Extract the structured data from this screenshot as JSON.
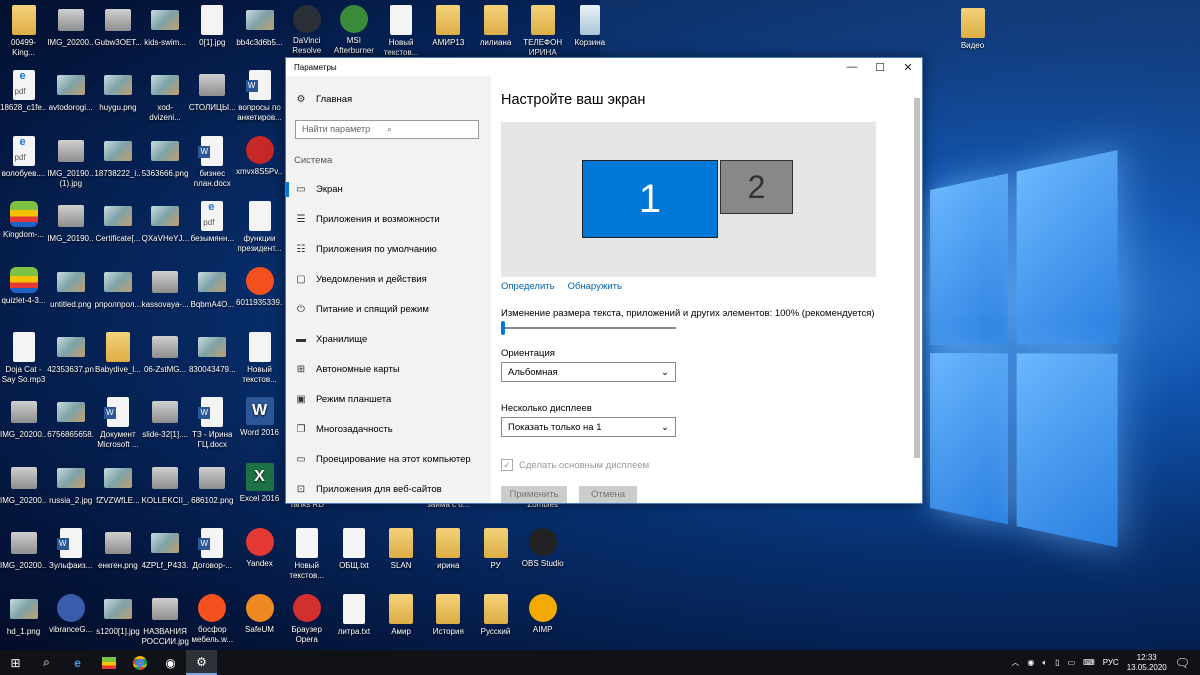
{
  "desktop": {
    "grid": [
      [
        [
          "00499-King...",
          "folder"
        ],
        [
          "IMG_20200...",
          "img"
        ],
        [
          "Gubw3OET...",
          "img"
        ],
        [
          "kids-swim...",
          "pic"
        ],
        [
          "0[1].jpg",
          "doc"
        ],
        [
          "bb4c3d6b5...",
          "pic"
        ],
        [
          "DaVinci Resolve Pro...",
          "app",
          "#2a2f38"
        ],
        [
          "MSI Afterburner",
          "app",
          "#3a8a3a"
        ],
        [
          "Новый текстов...",
          "doc"
        ],
        [
          "АМИР13",
          "folder"
        ],
        [
          "лилиана",
          "folder"
        ],
        [
          "ТЕЛЕФОН ИРИНА",
          "folder"
        ],
        [
          "Корзина",
          "bin"
        ]
      ],
      [
        [
          "18628_c1fe...",
          "pdf"
        ],
        [
          "avtodorogi...",
          "pic"
        ],
        [
          "huygu.png",
          "pic"
        ],
        [
          "xod-dvizeni...",
          "pic"
        ],
        [
          "СТОЛИЦЫ...",
          "img"
        ],
        [
          "вопросы по анкетиров...",
          "word"
        ]
      ],
      [
        [
          "волобуев....",
          "pdf"
        ],
        [
          "IMG_20190... (1).jpg",
          "img"
        ],
        [
          "18738222_i...",
          "pic"
        ],
        [
          "5363666.png",
          "pic"
        ],
        [
          "бизнес план.docx",
          "word"
        ],
        [
          "xmvx8S5Pv...",
          "app",
          "#c62828"
        ]
      ],
      [
        [
          "Kingdom-...",
          "bs"
        ],
        [
          "IMG_20190...",
          "img"
        ],
        [
          "Certificate[...",
          "pic"
        ],
        [
          "QXaVHeYJ...",
          "pic"
        ],
        [
          "безымянн...",
          "pdf"
        ],
        [
          "функции президент...",
          "doc"
        ]
      ],
      [
        [
          "quizlet-4-3...",
          "bs"
        ],
        [
          "untitled.png",
          "pic"
        ],
        [
          "рпролпрол...",
          "pic"
        ],
        [
          "kassovaya-...",
          "img"
        ],
        [
          "BqbmA4O...",
          "pic"
        ],
        [
          "6011935339...",
          "app",
          "#f4511e"
        ]
      ],
      [
        [
          "Doja Cat - Say So.mp3",
          "doc"
        ],
        [
          "42353637.png",
          "pic"
        ],
        [
          "Babydive_l...",
          "folder"
        ],
        [
          "06-ZstMG...",
          "img"
        ],
        [
          "830043479...",
          "pic"
        ],
        [
          "Новый текстов...",
          "doc"
        ]
      ],
      [
        [
          "IMG_20200...",
          "img"
        ],
        [
          "6756865658...",
          "pic"
        ],
        [
          "Документ Microsoft ...",
          "word"
        ],
        [
          "slide-32[1]....",
          "img"
        ],
        [
          "ТЗ - Ирина ГЦ.docx",
          "word"
        ],
        [
          "Word 2016",
          "wordapp"
        ]
      ],
      [
        [
          "IMG_20200...",
          "img"
        ],
        [
          "russia_2.jpg",
          "pic"
        ],
        [
          "fZVZWfLE...",
          "pic"
        ],
        [
          "KOLLEKCII_...",
          "img"
        ],
        [
          "686102.png",
          "img"
        ],
        [
          "Excel 2016",
          "excel"
        ]
      ],
      [
        [
          "IMG_20200...",
          "img"
        ],
        [
          "Зульфаиз...",
          "word"
        ],
        [
          "енкген.png",
          "img"
        ],
        [
          "4ZPLf_P433...",
          "pic"
        ],
        [
          "Договор-...",
          "word"
        ],
        [
          "Yandex",
          "app",
          "#e53935"
        ],
        [
          "Новый текстов...",
          "doc"
        ],
        [
          "ОБЩ.txt",
          "doc"
        ],
        [
          "SLAN",
          "folder"
        ],
        [
          "ирина",
          "folder"
        ],
        [
          "РУ",
          "folder"
        ],
        [
          "OBS Studio",
          "app",
          "#222"
        ]
      ],
      [
        [
          "hd_1.png",
          "pic"
        ],
        [
          "vibranceG...",
          "app",
          "#3b5bab"
        ],
        [
          "s1200[1].jpg",
          "pic"
        ],
        [
          "НАЗВАНИЯ РОССИИ.jpg",
          "img"
        ],
        [
          "босфор мебель.w...",
          "app",
          "#f4511e"
        ],
        [
          "SafeUM",
          "app",
          "#ef8a22"
        ],
        [
          "Браузер Opera",
          "app",
          "#d32f2f"
        ],
        [
          "литра.txt",
          "doc"
        ],
        [
          "Амир",
          "folder"
        ],
        [
          "История",
          "folder"
        ],
        [
          "Русский",
          "folder"
        ],
        [
          "AIMP",
          "app",
          "#f2a900"
        ]
      ]
    ],
    "partial_labels": [
      "Tanks RD",
      "займа с о...",
      "Zombies"
    ],
    "video_folder": "Видео"
  },
  "settings": {
    "window_title": "Параметры",
    "home": "Главная",
    "search_placeholder": "Найти параметр",
    "section": "Система",
    "nav": [
      {
        "label": "Экран",
        "icon": "▭",
        "active": true
      },
      {
        "label": "Приложения и возможности",
        "icon": "☰"
      },
      {
        "label": "Приложения по умолчанию",
        "icon": "☷"
      },
      {
        "label": "Уведомления и действия",
        "icon": "▢"
      },
      {
        "label": "Питание и спящий режим",
        "icon": "⏻"
      },
      {
        "label": "Хранилище",
        "icon": "▬"
      },
      {
        "label": "Автономные карты",
        "icon": "⊞"
      },
      {
        "label": "Режим планшета",
        "icon": "▣"
      },
      {
        "label": "Многозадачность",
        "icon": "❐"
      },
      {
        "label": "Проецирование на этот компьютер",
        "icon": "▭"
      },
      {
        "label": "Приложения для веб-сайтов",
        "icon": "⊡"
      }
    ],
    "heading": "Настройте ваш экран",
    "monitor1": "1",
    "monitor2": "2",
    "identify": "Определить",
    "detect": "Обнаружить",
    "scale_label": "Изменение размера текста, приложений и других элементов: 100% (рекомендуется)",
    "scale_value_percent": 100,
    "orientation_label": "Ориентация",
    "orientation_value": "Альбомная",
    "multi_label": "Несколько дисплеев",
    "multi_value": "Показать только на 1",
    "main_display": "Сделать основным дисплеем",
    "apply": "Применить",
    "cancel": "Отмена",
    "accent": "#0078d7"
  },
  "taskbar": {
    "lang": "РУС",
    "time": "12:33",
    "date": "13.05.2020"
  }
}
